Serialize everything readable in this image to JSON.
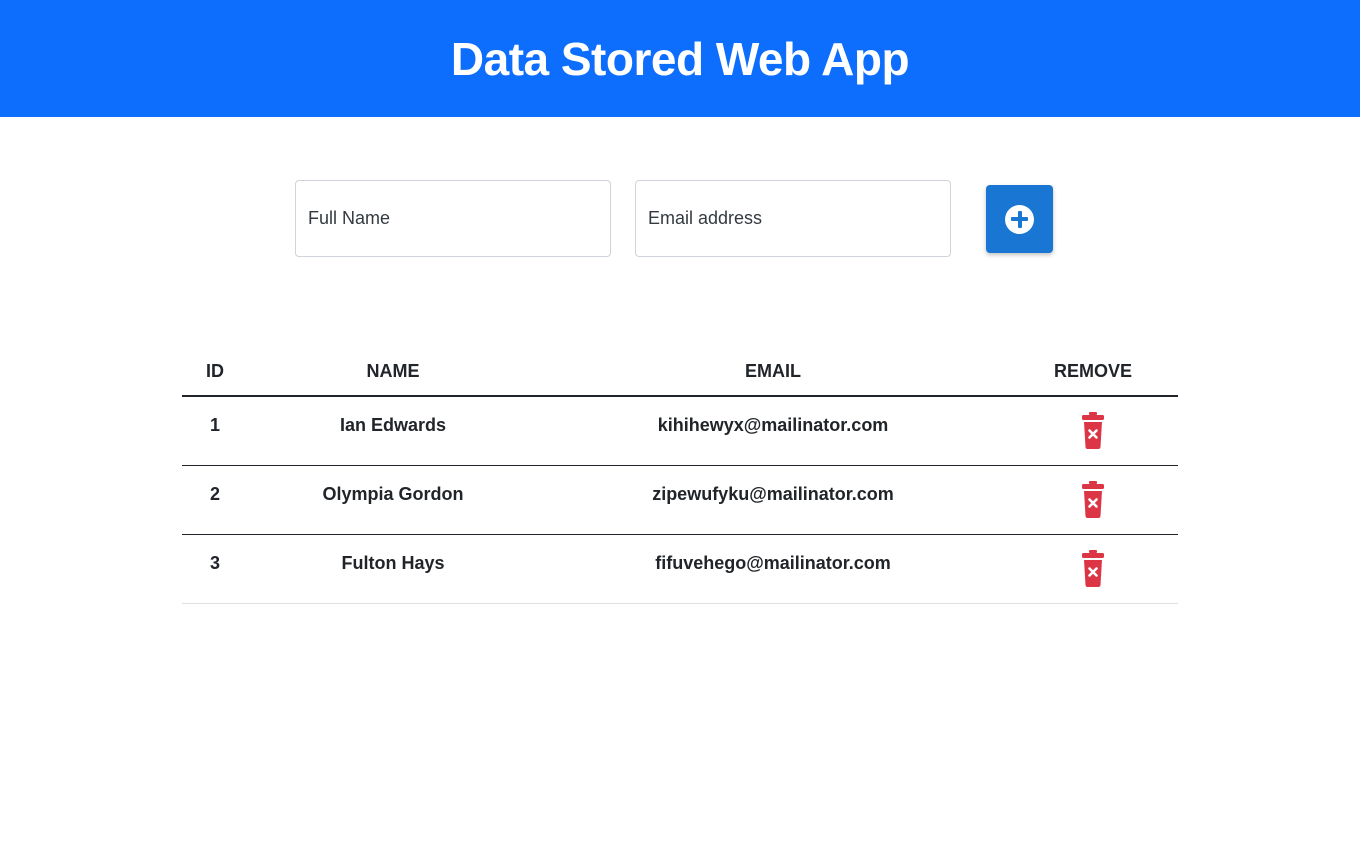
{
  "header": {
    "title": "Data Stored Web App",
    "background_color": "#0d6efd"
  },
  "form": {
    "name_placeholder": "Full Name",
    "email_placeholder": "Email address",
    "add_button_icon": "plus-circle-icon",
    "add_button_color": "#1976d2"
  },
  "table": {
    "headers": {
      "id": "ID",
      "name": "NAME",
      "email": "EMAIL",
      "remove": "REMOVE"
    },
    "remove_icon": "trash-icon",
    "remove_icon_color": "#dc3545",
    "rows": [
      {
        "id": "1",
        "name": "Ian Edwards",
        "email": "kihihewyx@mailinator.com"
      },
      {
        "id": "2",
        "name": "Olympia Gordon",
        "email": "zipewufyku@mailinator.com"
      },
      {
        "id": "3",
        "name": "Fulton Hays",
        "email": "fifuvehego@mailinator.com"
      }
    ]
  }
}
